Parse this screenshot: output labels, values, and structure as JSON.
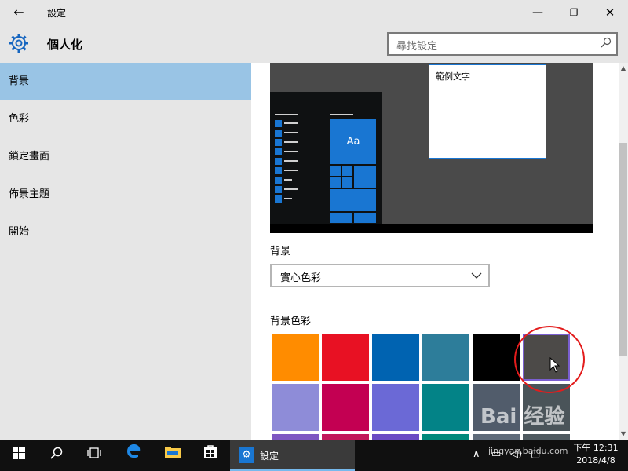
{
  "titlebar": {
    "back_icon": "←",
    "title": "設定",
    "minimize_icon": "—",
    "maximize_icon": "❐",
    "close_icon": "✕"
  },
  "header": {
    "title": "個人化",
    "search_placeholder": "尋找設定"
  },
  "sidebar": {
    "items": [
      {
        "label": "背景",
        "active": true
      },
      {
        "label": "色彩",
        "active": false
      },
      {
        "label": "鎖定畫面",
        "active": false
      },
      {
        "label": "佈景主題",
        "active": false
      },
      {
        "label": "開始",
        "active": false
      }
    ]
  },
  "preview": {
    "window_text": "範例文字",
    "tile_text": "Aa"
  },
  "background_section": {
    "label": "背景",
    "dropdown_value": "實心色彩"
  },
  "color_section": {
    "label": "背景色彩",
    "swatches_row1": [
      "#ff8c00",
      "#e81123",
      "#0063b1",
      "#2d7d9a",
      "#000000",
      "#4c4a48"
    ],
    "swatches_row2": [
      "#8e8cd8",
      "#c30052",
      "#6b69d6",
      "#038387",
      "#515c6b",
      "#4a5459"
    ],
    "selected_index": 5
  },
  "taskbar": {
    "settings_label": "設定",
    "clock_time": "下午 12:31",
    "clock_date": "2018/4/8"
  },
  "watermark": {
    "text": "Bai 经验",
    "url": "jingyan.baidu.com"
  }
}
